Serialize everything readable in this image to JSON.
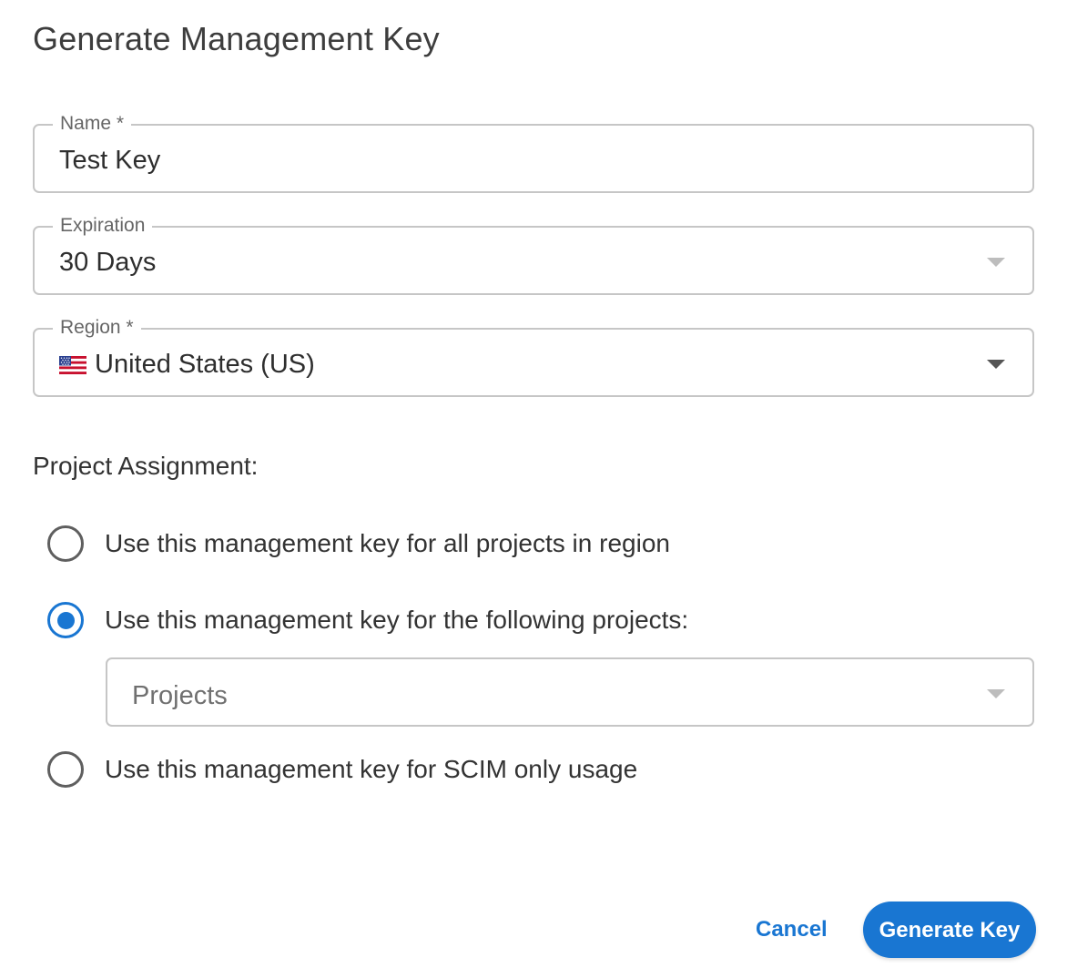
{
  "dialog": {
    "title": "Generate Management Key"
  },
  "fields": {
    "name": {
      "label": "Name *",
      "value": "Test Key"
    },
    "expiration": {
      "label": "Expiration",
      "value": "30 Days"
    },
    "region": {
      "label": "Region *",
      "flag_icon": "us-flag-icon",
      "value": "United States (US)"
    }
  },
  "project_assignment": {
    "label": "Project Assignment:",
    "options": [
      {
        "label": "Use this management key for all projects in region",
        "selected": false
      },
      {
        "label": "Use this management key for the following projects:",
        "selected": true
      },
      {
        "label": "Use this management key for SCIM only usage",
        "selected": false
      }
    ],
    "projects_select": {
      "placeholder": "Projects"
    }
  },
  "actions": {
    "cancel_label": "Cancel",
    "generate_label": "Generate Key"
  },
  "colors": {
    "accent": "#1976d2",
    "border": "#c6c6c6"
  }
}
